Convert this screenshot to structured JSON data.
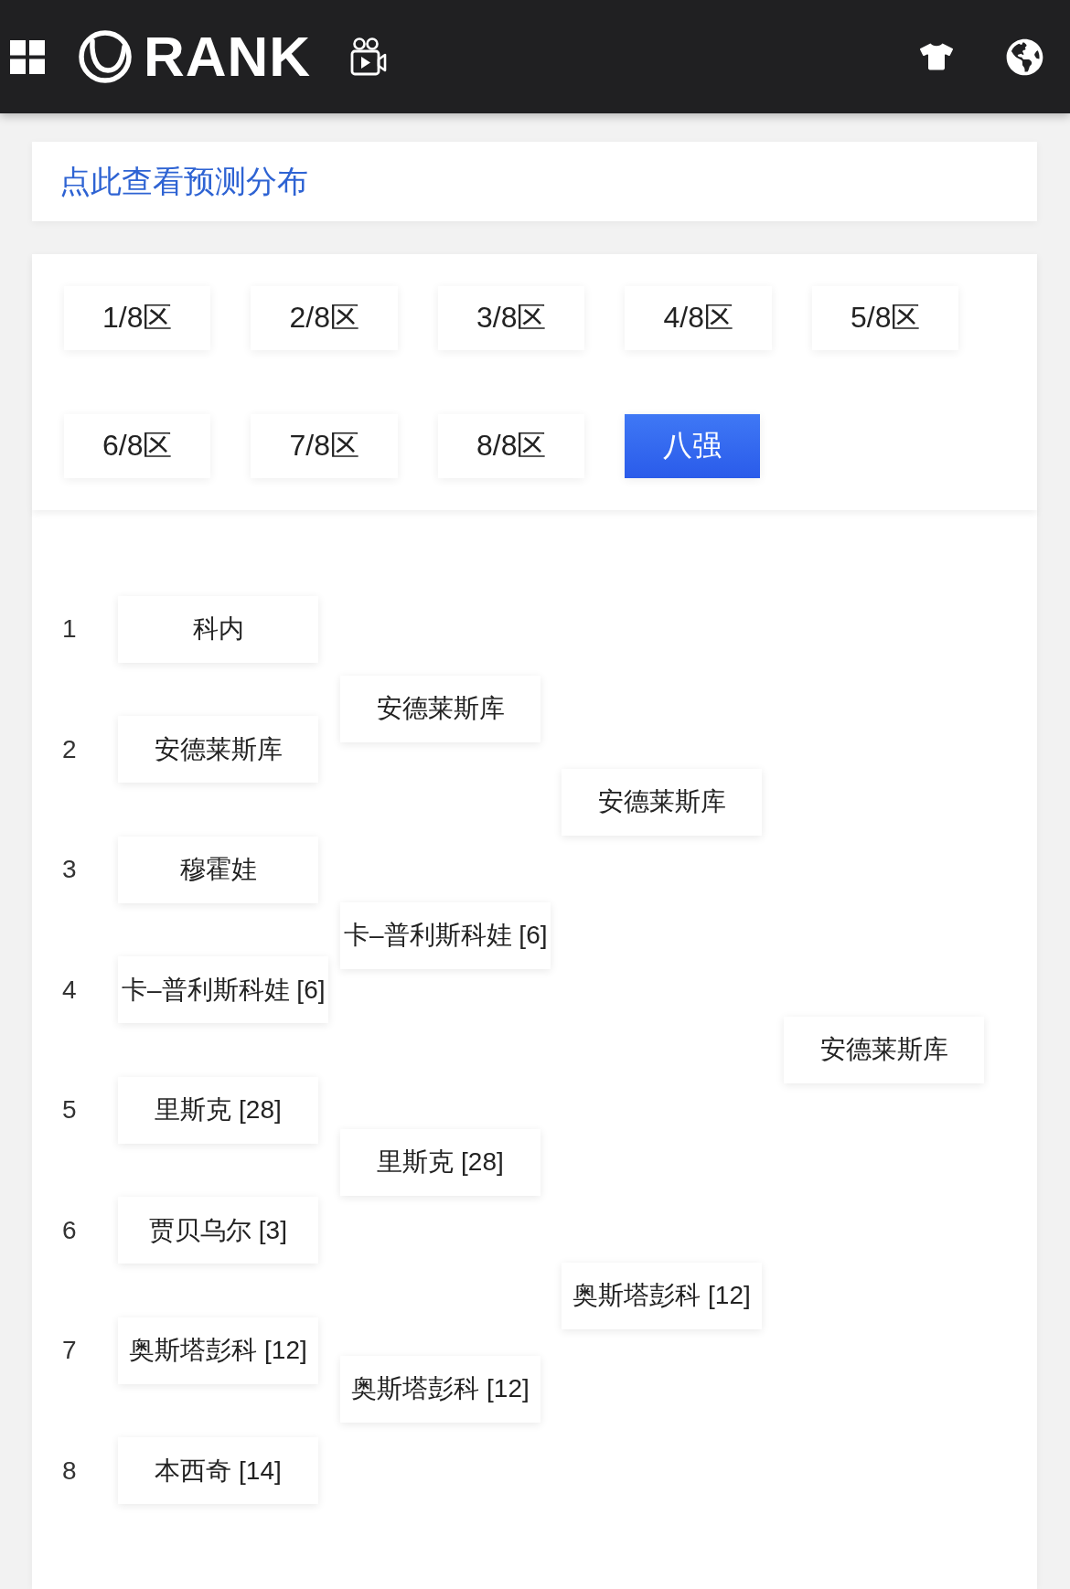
{
  "header": {
    "logo_text": "RANK"
  },
  "prediction_link": {
    "label": "点此查看预测分布"
  },
  "tabs": [
    {
      "label": "1/8区",
      "selected": false
    },
    {
      "label": "2/8区",
      "selected": false
    },
    {
      "label": "3/8区",
      "selected": false
    },
    {
      "label": "4/8区",
      "selected": false
    },
    {
      "label": "5/8区",
      "selected": false
    },
    {
      "label": "6/8区",
      "selected": false
    },
    {
      "label": "7/8区",
      "selected": false
    },
    {
      "label": "8/8区",
      "selected": false
    },
    {
      "label": "八强",
      "selected": true
    }
  ],
  "bracket": {
    "seeds": [
      {
        "number": "1",
        "player": "科内"
      },
      {
        "number": "2",
        "player": "安德莱斯库"
      },
      {
        "number": "3",
        "player": "穆霍娃"
      },
      {
        "number": "4",
        "player": "卡–普利斯科娃 [6]"
      },
      {
        "number": "5",
        "player": "里斯克 [28]"
      },
      {
        "number": "6",
        "player": "贾贝乌尔 [3]"
      },
      {
        "number": "7",
        "player": "奥斯塔彭科 [12]"
      },
      {
        "number": "8",
        "player": "本西奇 [14]"
      }
    ],
    "rounds": [
      {
        "winners": [
          "安德莱斯库",
          "卡–普利斯科娃 [6]",
          "里斯克 [28]",
          "奥斯塔彭科 [12]"
        ]
      },
      {
        "winners": [
          "安德莱斯库",
          "奥斯塔彭科 [12]"
        ]
      },
      {
        "winners": [
          "安德莱斯库"
        ]
      }
    ]
  }
}
